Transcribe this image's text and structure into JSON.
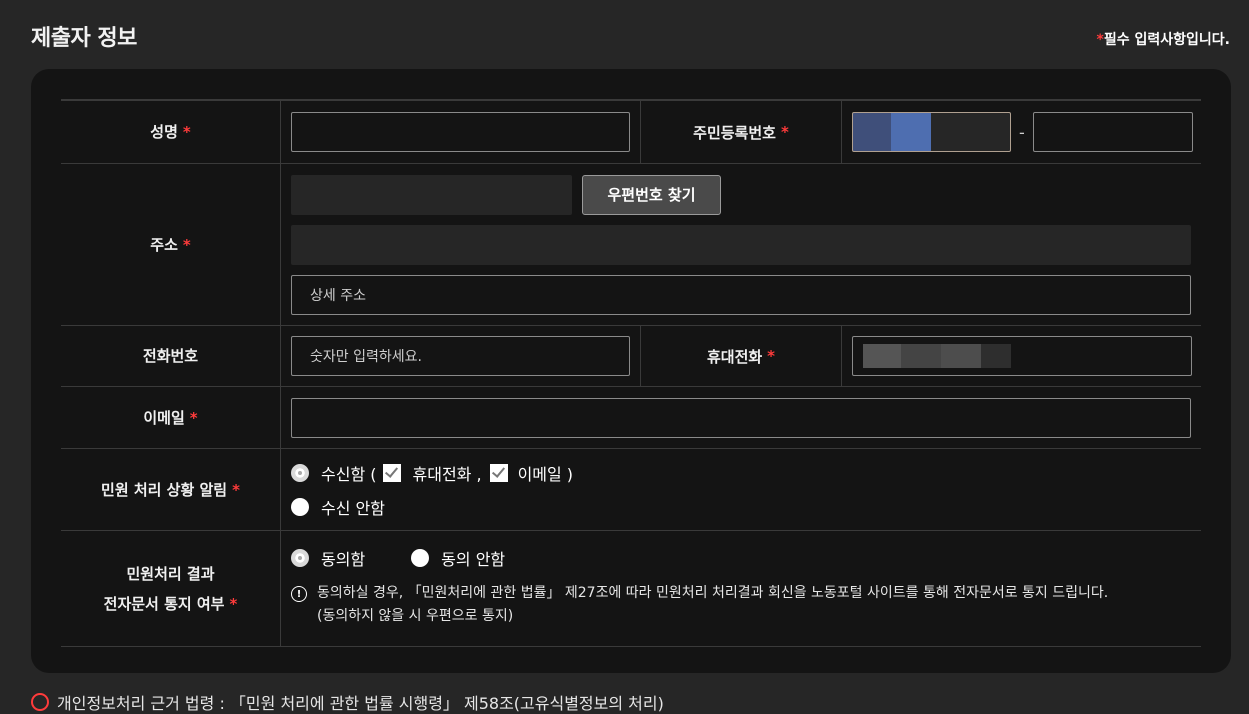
{
  "header": {
    "title": "제출자 정보",
    "required_star": "*",
    "required_note": "필수 입력사항입니다."
  },
  "form": {
    "star": "*",
    "name_label": "성명",
    "rrn_label": "주민등록번호",
    "rrn_separator": "-",
    "address_label": "주소",
    "zip_button": "우편번호 찾기",
    "detail_address_placeholder": "상세 주소",
    "phone_label": "전화번호",
    "phone_placeholder": "숫자만 입력하세요.",
    "mobile_label": "휴대전화",
    "email_label": "이메일",
    "notify_label": "민원 처리 상황 알림",
    "notify_receive": "수신함 (",
    "notify_mobile": "휴대전화 ,",
    "notify_email": "이메일 )",
    "notify_reject": "수신 안함",
    "edoc_label_line1": "민원처리 결과",
    "edoc_label_line2": "전자문서 통지 여부",
    "edoc_agree": "동의함",
    "edoc_disagree": "동의 안함",
    "edoc_notice_line1": "동의하실 경우, 「민원처리에 관한 법률」 제27조에 따라 민원처리 처리결과 회신을 노동포털 사이트를 통해 전자문서로 통지 드립니다.",
    "edoc_notice_line2": "(동의하지 않을 시 우편으로 통지)"
  },
  "footer": {
    "text": "개인정보처리 근거 법령 : 「민원 처리에 관한 법률 시행령」 제58조(고유식별정보의 처리)"
  },
  "colors": {
    "background": "#262626",
    "card": "#141414",
    "required": "#ff3b3b"
  }
}
